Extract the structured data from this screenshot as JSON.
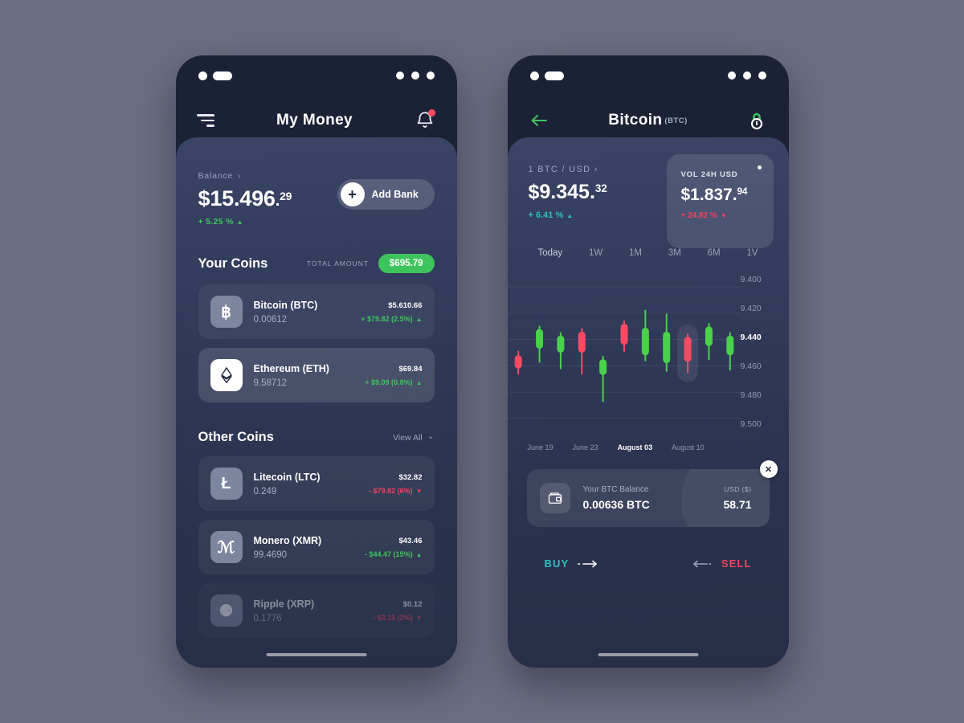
{
  "left_phone": {
    "statusbar": {
      "icon_left": "dot-pill-indicator",
      "icon_right": "three-dots-indicator"
    },
    "nav": {
      "menu_icon": "hamburger-menu-icon",
      "title": "My Money",
      "bell_icon": "notification-bell-icon"
    },
    "balance": {
      "label": "Balance",
      "chevron": "›",
      "amount_main": "$15.496",
      "amount_sep": ".",
      "amount_cents": "29",
      "delta": "+ 5.25 %",
      "delta_direction": "up"
    },
    "add_bank": {
      "plus": "+",
      "label": "Add Bank"
    },
    "your_coins": {
      "title": "Your Coins",
      "total_label": "TOTAL AMOUNT",
      "total_value": "$695.79",
      "rows": [
        {
          "icon": "bitcoin-icon",
          "glyph": "฿",
          "name": "Bitcoin (BTC)",
          "qty": "0.00612",
          "price": "$5.610.66",
          "delta": "+ $79.82 (2.5%)",
          "direction": "up",
          "highlight": false
        },
        {
          "icon": "ethereum-icon",
          "glyph": "⧫",
          "name": "Ethereum (ETH)",
          "qty": "9.58712",
          "price": "$69.84",
          "delta": "+ $9.09 (0.8%)",
          "direction": "up",
          "highlight": true
        }
      ]
    },
    "other_coins": {
      "title": "Other Coins",
      "view_all": "View All",
      "rows": [
        {
          "icon": "litecoin-icon",
          "glyph": "Ł",
          "name": "Litecoin (LTC)",
          "qty": "0.249",
          "price": "$32.82",
          "delta": "- $79.82 (6%)",
          "direction": "down",
          "faded": false
        },
        {
          "icon": "monero-icon",
          "glyph": "ℳ",
          "name": "Monero (XMR)",
          "qty": "99.4690",
          "price": "$43.46",
          "delta": "- $44.47 (15%)",
          "direction": "up",
          "faded": false
        },
        {
          "icon": "ripple-icon",
          "glyph": "⚈",
          "name": "Ripple (XRP)",
          "qty": "0.1776",
          "price": "$0.12",
          "delta": "- $3.15 (2%)",
          "direction": "down",
          "faded": true
        }
      ]
    },
    "home_indicator": "home-bar"
  },
  "right_phone": {
    "statusbar": {
      "icon_left": "dot-pill-indicator",
      "icon_right": "three-dots-indicator"
    },
    "nav": {
      "back_icon": "back-arrow-icon",
      "title": "Bitcoin",
      "ticker": "(BTC)",
      "lock_icon": "padlock-icon"
    },
    "quote": {
      "pair_label": "1 BTC  /  USD ›",
      "price_main": "$9.345",
      "price_sep": ".",
      "price_cents": "32",
      "delta": "+ 6.41 %",
      "delta_direction": "up"
    },
    "vol_card": {
      "label": "VOL 24H USD",
      "price_main": "$1.837",
      "price_sep": ".",
      "price_cents": "94",
      "delta": "+ 24.82 %",
      "delta_direction": "down"
    },
    "ranges": [
      {
        "label": "Today",
        "active": true
      },
      {
        "label": "1W",
        "active": false
      },
      {
        "label": "1M",
        "active": false
      },
      {
        "label": "3M",
        "active": false
      },
      {
        "label": "6M",
        "active": false
      },
      {
        "label": "1V",
        "active": false
      }
    ],
    "balance_card": {
      "wallet_icon": "wallet-icon",
      "caption": "Your BTC Balance",
      "value": "0.00636 BTC",
      "usd_caption": "USD ($)",
      "usd_value": "58.71",
      "close_icon": "✕"
    },
    "actions": {
      "buy_label": "BUY",
      "buy_color": "#2fc0bd",
      "sell_label": "SELL",
      "sell_color": "#f2425f"
    },
    "home_indicator": "home-bar"
  },
  "chart_data": {
    "type": "candlestick",
    "title": "Bitcoin (BTC) price chart",
    "xlabel": "",
    "ylabel": "",
    "grid": true,
    "y_ticks": [
      "9.400",
      "9.420",
      "9.440",
      "9.460",
      "9.480",
      "9.500"
    ],
    "y_active_tick": "9.440",
    "y_axis_inverted": true,
    "x_ticks": [
      "June 19",
      "June 23",
      "August 03",
      "August 10"
    ],
    "x_active_tick": "August 03",
    "up_color": "#49d24a",
    "down_color": "#fa4a63",
    "selected_index": 8,
    "candles": [
      {
        "open": 9.452,
        "close": 9.462,
        "high": 9.449,
        "low": 9.466,
        "dir": "down"
      },
      {
        "open": 9.432,
        "close": 9.447,
        "high": 9.43,
        "low": 9.457,
        "dir": "up"
      },
      {
        "open": 9.437,
        "close": 9.45,
        "high": 9.435,
        "low": 9.462,
        "dir": "up"
      },
      {
        "open": 9.434,
        "close": 9.45,
        "high": 9.432,
        "low": 9.466,
        "dir": "down"
      },
      {
        "open": 9.455,
        "close": 9.467,
        "high": 9.453,
        "low": 9.487,
        "dir": "up"
      },
      {
        "open": 9.428,
        "close": 9.444,
        "high": 9.426,
        "low": 9.449,
        "dir": "down"
      },
      {
        "open": 9.431,
        "close": 9.452,
        "high": 9.418,
        "low": 9.456,
        "dir": "up"
      },
      {
        "open": 9.434,
        "close": 9.458,
        "high": 9.421,
        "low": 9.464,
        "dir": "up"
      },
      {
        "open": 9.438,
        "close": 9.457,
        "high": 9.436,
        "low": 9.465,
        "dir": "down"
      },
      {
        "open": 9.43,
        "close": 9.445,
        "high": 9.428,
        "low": 9.455,
        "dir": "up"
      },
      {
        "open": 9.437,
        "close": 9.452,
        "high": 9.435,
        "low": 9.463,
        "dir": "up"
      }
    ]
  }
}
